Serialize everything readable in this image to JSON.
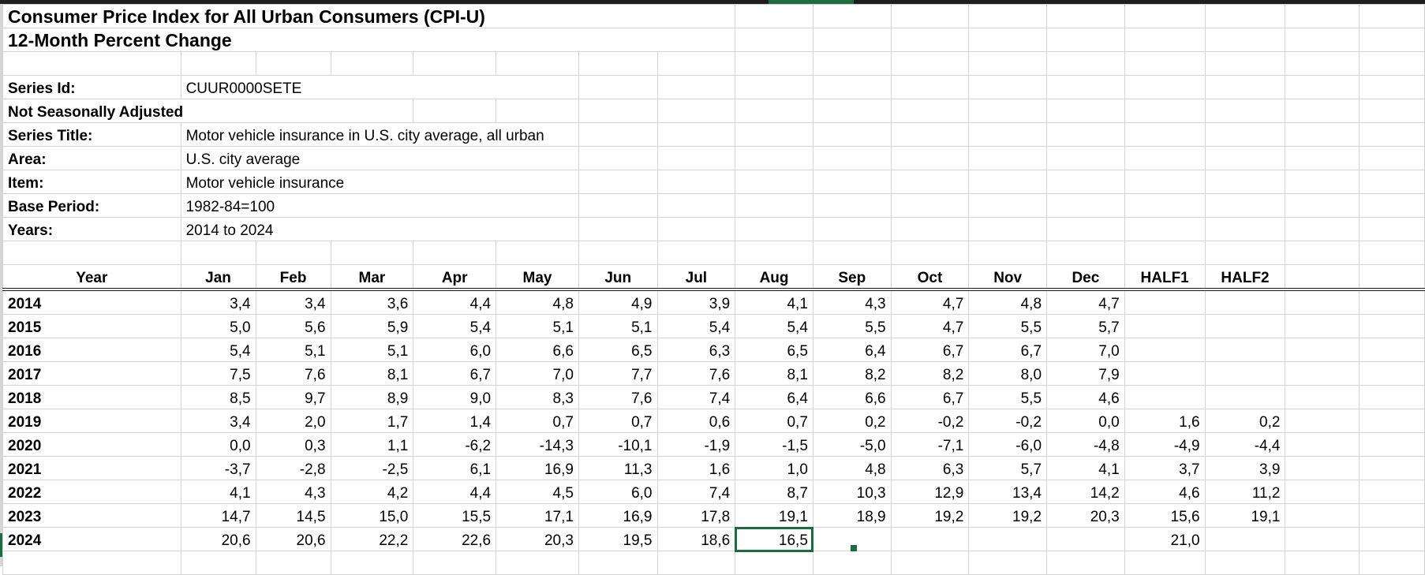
{
  "sheet": {
    "title": "Consumer Price Index for All Urban Consumers (CPI-U)",
    "subtitle": "12-Month Percent Change",
    "meta": [
      {
        "label": "Series Id:",
        "value": "CUUR0000SETE"
      },
      {
        "label": "Not Seasonally Adjusted",
        "value": ""
      },
      {
        "label": "Series Title:",
        "value": "Motor vehicle insurance in U.S. city average, all urban"
      },
      {
        "label": "Area:",
        "value": "U.S. city average"
      },
      {
        "label": "Item:",
        "value": "Motor vehicle insurance"
      },
      {
        "label": "Base Period:",
        "value": "1982-84=100"
      },
      {
        "label": "Years:",
        "value": "2014 to 2024"
      }
    ],
    "headers": [
      "Year",
      "Jan",
      "Feb",
      "Mar",
      "Apr",
      "May",
      "Jun",
      "Jul",
      "Aug",
      "Sep",
      "Oct",
      "Nov",
      "Dec",
      "HALF1",
      "HALF2"
    ],
    "rows": [
      [
        "2014",
        "3,4",
        "3,4",
        "3,6",
        "4,4",
        "4,8",
        "4,9",
        "3,9",
        "4,1",
        "4,3",
        "4,7",
        "4,8",
        "4,7",
        "",
        ""
      ],
      [
        "2015",
        "5,0",
        "5,6",
        "5,9",
        "5,4",
        "5,1",
        "5,1",
        "5,4",
        "5,4",
        "5,5",
        "4,7",
        "5,5",
        "5,7",
        "",
        ""
      ],
      [
        "2016",
        "5,4",
        "5,1",
        "5,1",
        "6,0",
        "6,6",
        "6,5",
        "6,3",
        "6,5",
        "6,4",
        "6,7",
        "6,7",
        "7,0",
        "",
        ""
      ],
      [
        "2017",
        "7,5",
        "7,6",
        "8,1",
        "6,7",
        "7,0",
        "7,7",
        "7,6",
        "8,1",
        "8,2",
        "8,2",
        "8,0",
        "7,9",
        "",
        ""
      ],
      [
        "2018",
        "8,5",
        "9,7",
        "8,9",
        "9,0",
        "8,3",
        "7,6",
        "7,4",
        "6,4",
        "6,6",
        "6,7",
        "5,5",
        "4,6",
        "",
        ""
      ],
      [
        "2019",
        "3,4",
        "2,0",
        "1,7",
        "1,4",
        "0,7",
        "0,7",
        "0,6",
        "0,7",
        "0,2",
        "-0,2",
        "-0,2",
        "0,0",
        "1,6",
        "0,2"
      ],
      [
        "2020",
        "0,0",
        "0,3",
        "1,1",
        "-6,2",
        "-14,3",
        "-10,1",
        "-1,9",
        "-1,5",
        "-5,0",
        "-7,1",
        "-6,0",
        "-4,8",
        "-4,9",
        "-4,4"
      ],
      [
        "2021",
        "-3,7",
        "-2,8",
        "-2,5",
        "6,1",
        "16,9",
        "11,3",
        "1,6",
        "1,0",
        "4,8",
        "6,3",
        "5,7",
        "4,1",
        "3,7",
        "3,9"
      ],
      [
        "2022",
        "4,1",
        "4,3",
        "4,2",
        "4,4",
        "4,5",
        "6,0",
        "7,4",
        "8,7",
        "10,3",
        "12,9",
        "13,4",
        "14,2",
        "4,6",
        "11,2"
      ],
      [
        "2023",
        "14,7",
        "14,5",
        "15,0",
        "15,5",
        "17,1",
        "16,9",
        "17,8",
        "19,1",
        "18,9",
        "19,2",
        "19,2",
        "20,3",
        "15,6",
        "19,1"
      ],
      [
        "2024",
        "20,6",
        "20,6",
        "22,2",
        "22,6",
        "20,3",
        "19,5",
        "18,6",
        "16,5",
        "",
        "",
        "",
        "",
        "21,0",
        ""
      ]
    ],
    "selected_cell": {
      "row": 10,
      "col": 8
    },
    "colors": {
      "selection": "#1d6b3f",
      "gridline": "#d4d4d4"
    }
  }
}
